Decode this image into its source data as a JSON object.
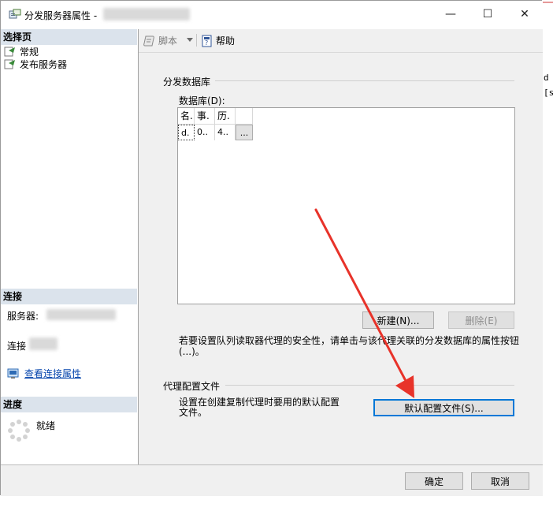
{
  "window": {
    "title": "分发服务器属性 - ",
    "minimize_glyph": "—",
    "maximize_glyph": "☐",
    "close_glyph": "✕"
  },
  "background_editor": {
    "line1_suffix": "d",
    "line2_suffix": "[s"
  },
  "left_pane": {
    "select_page_header": "选择页",
    "pages": [
      {
        "label": "常规"
      },
      {
        "label": "发布服务器"
      }
    ],
    "connection_header": "连接",
    "server_label": "服务器:",
    "connection_label": "连接",
    "view_connection_link": "查看连接属性",
    "progress_header": "进度",
    "progress_status": "就绪"
  },
  "toolbar": {
    "script_label": "脚本",
    "help_label": "帮助"
  },
  "distribution_db": {
    "group_title": "分发数据库",
    "databases_label": "数据库(D):",
    "columns": [
      "名.",
      "事.",
      "历.",
      ""
    ],
    "rows": [
      {
        "name": "d.",
        "transaction": "0..",
        "history": "4..",
        "browse": "..."
      }
    ],
    "new_button": "新建(N)...",
    "delete_button": "删除(E)",
    "hint_text": "若要设置队列读取器代理的安全性，请单击与该代理关联的分发数据库的属性按钮(...)。"
  },
  "agent_profile": {
    "group_title": "代理配置文件",
    "description": "设置在创建复制代理时要用的默认配置文件。",
    "default_profiles_button": "默认配置文件(S)..."
  },
  "footer": {
    "ok_button": "确定",
    "cancel_button": "取消"
  },
  "colors": {
    "annotation_arrow": "#e8332a",
    "section_header_bg": "#dbe3ec",
    "default_button_border": "#0078d7",
    "link_color": "#0645ad"
  }
}
